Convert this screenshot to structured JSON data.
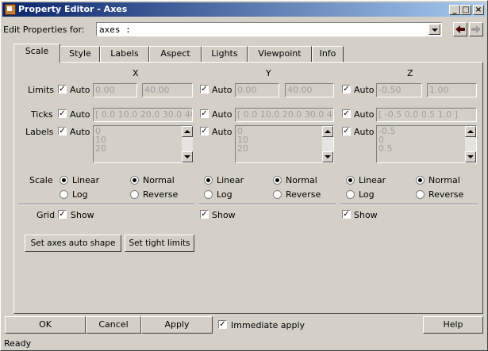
{
  "window": {
    "title": "Property Editor - Axes"
  },
  "controls": {
    "minimize": "_",
    "maximize": "□",
    "close": "×"
  },
  "header": {
    "edit_label": "Edit Properties for:",
    "target_value": "axes :"
  },
  "tabs": [
    "Scale",
    "Style",
    "Labels",
    "Aspect",
    "Lights",
    "Viewpoint",
    "Info"
  ],
  "axes_headers": {
    "x": "X",
    "y": "Y",
    "z": "Z"
  },
  "row_labels": {
    "limits": "Limits",
    "ticks": "Ticks",
    "labels": "Labels",
    "scale": "Scale",
    "grid": "Grid"
  },
  "auto_label": "Auto",
  "check_mark": "✓",
  "x": {
    "limits": [
      "0.00",
      "40.00"
    ],
    "ticks": "[ 0.0 10.0 20.0 30.0 40",
    "labels": [
      "0",
      "10",
      "20"
    ],
    "scale": [
      "Linear",
      "Log"
    ],
    "direction": [
      "Normal",
      "Reverse"
    ],
    "grid": "Show"
  },
  "y": {
    "limits": [
      "0.00",
      "40.00"
    ],
    "ticks": "[ 0.0 10.0 20.0 30.0 40",
    "labels": [
      "0",
      "10",
      "20"
    ],
    "scale": [
      "Linear",
      "Log"
    ],
    "direction": [
      "Normal",
      "Reverse"
    ],
    "grid": "Show"
  },
  "z": {
    "limits": [
      "-0.50",
      "1.00"
    ],
    "ticks": "[ -0.5 0.0 0.5 1.0 ]",
    "labels": [
      "-0.5",
      "0",
      "0.5"
    ],
    "scale": [
      "Linear",
      "Log"
    ],
    "direction": [
      "Normal",
      "Reverse"
    ],
    "grid": "Show"
  },
  "actions": {
    "auto_shape": "Set axes auto shape",
    "tight_limits": "Set tight limits"
  },
  "footer": {
    "ok": "OK",
    "cancel": "Cancel",
    "apply": "Apply",
    "immediate": "Immediate apply",
    "help": "Help"
  },
  "status": "Ready"
}
